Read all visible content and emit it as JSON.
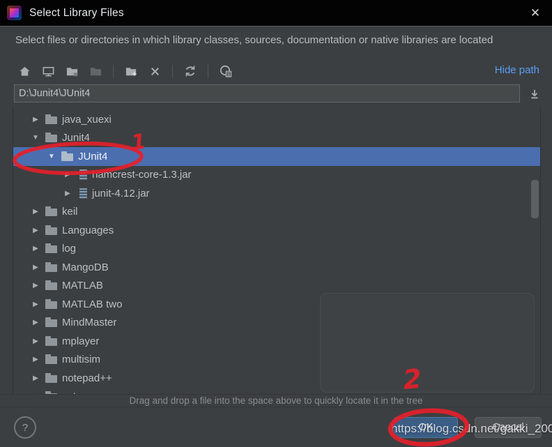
{
  "window": {
    "title": "Select Library Files",
    "close_glyph": "✕"
  },
  "subtitle": "Select files or directories in which library classes, sources, documentation or native libraries are located",
  "toolbar": {
    "icons": [
      "home",
      "desktop",
      "project-directory",
      "module-directory",
      "new-folder",
      "delete",
      "refresh",
      "show-hidden-files"
    ],
    "hide_path_label": "Hide path"
  },
  "path_field": {
    "value": "D:\\Junit4\\JUnit4"
  },
  "tree": {
    "items": [
      {
        "label": "java_xuexi",
        "level": 1,
        "state": "collapsed",
        "icon": "folder",
        "selected": false
      },
      {
        "label": "Junit4",
        "level": 1,
        "state": "expanded",
        "icon": "folder",
        "selected": false
      },
      {
        "label": "JUnit4",
        "level": 2,
        "state": "expanded",
        "icon": "folder",
        "selected": true
      },
      {
        "label": "hamcrest-core-1.3.jar",
        "level": 3,
        "state": "collapsed",
        "icon": "jar",
        "selected": false
      },
      {
        "label": "junit-4.12.jar",
        "level": 3,
        "state": "collapsed",
        "icon": "jar",
        "selected": false
      },
      {
        "label": "keil",
        "level": 1,
        "state": "collapsed",
        "icon": "folder",
        "selected": false
      },
      {
        "label": "Languages",
        "level": 1,
        "state": "collapsed",
        "icon": "folder",
        "selected": false
      },
      {
        "label": "log",
        "level": 1,
        "state": "collapsed",
        "icon": "folder",
        "selected": false
      },
      {
        "label": "MangoDB",
        "level": 1,
        "state": "collapsed",
        "icon": "folder",
        "selected": false
      },
      {
        "label": "MATLAB",
        "level": 1,
        "state": "collapsed",
        "icon": "folder",
        "selected": false
      },
      {
        "label": "MATLAB two",
        "level": 1,
        "state": "collapsed",
        "icon": "folder",
        "selected": false
      },
      {
        "label": "MindMaster",
        "level": 1,
        "state": "collapsed",
        "icon": "folder",
        "selected": false
      },
      {
        "label": "mplayer",
        "level": 1,
        "state": "collapsed",
        "icon": "folder",
        "selected": false
      },
      {
        "label": "multisim",
        "level": 1,
        "state": "collapsed",
        "icon": "folder",
        "selected": false
      },
      {
        "label": "notepad++",
        "level": 1,
        "state": "collapsed",
        "icon": "folder",
        "selected": false
      },
      {
        "label": "octave",
        "level": 1,
        "state": "collapsed",
        "icon": "folder",
        "selected": false
      }
    ]
  },
  "status_text": "Drag and drop a file into the space above to quickly locate it in the tree",
  "footer": {
    "ok_label": "OK",
    "cancel_label": "Cancel",
    "help_label": "?"
  },
  "watermark": "https://blog.csdn.net/gakki_200",
  "annotations": {
    "step1": "1",
    "step2": "2",
    "color": "#e51f2a"
  },
  "colors": {
    "dialog_background": "#3c3f41",
    "titlebar_background": "#030303",
    "selection_blue": "#4b6eaf",
    "ok_button_blue": "#3b5e87",
    "link_blue": "#5a9df8",
    "annotation_red": "#e51f2a"
  }
}
